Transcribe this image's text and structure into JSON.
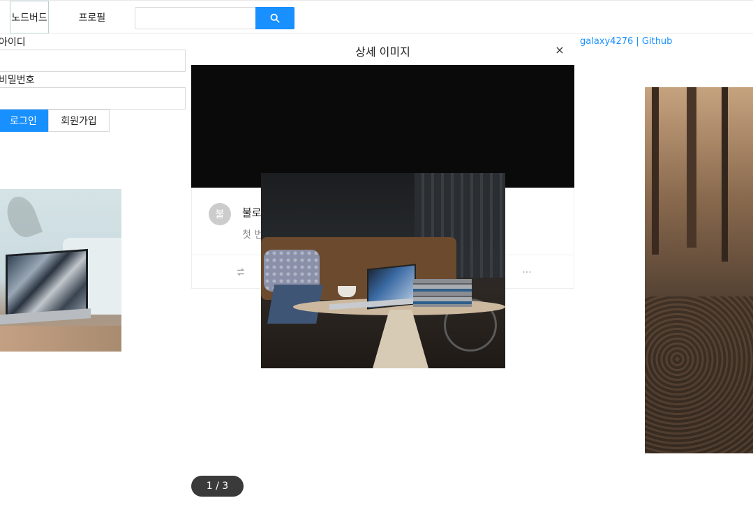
{
  "nav": {
    "home_label": "노드버드",
    "profile_label": "프로필",
    "search_placeholder": "",
    "search_value": ""
  },
  "login": {
    "id_label": "아이디",
    "id_value": "",
    "pw_label": "비밀번호",
    "pw_value": "",
    "login_button": "로그인",
    "signup_button": "회원가입"
  },
  "footer_link": "galaxy4276 | Github",
  "modal": {
    "title": "상세 이미지",
    "close_symbol": "×",
    "pagination": "1 / 3"
  },
  "post": {
    "avatar_initial": "불",
    "title": "불로",
    "description": "첫 번"
  },
  "colors": {
    "primary": "#1890ff",
    "pagination_bg": "#3a3a3a"
  }
}
